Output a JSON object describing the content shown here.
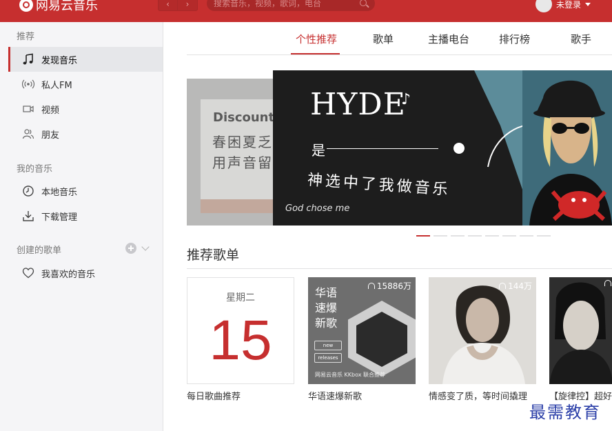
{
  "app": {
    "title": "网易云音乐",
    "search_placeholder": "搜索音乐，视频，歌词，电台",
    "user_label": "未登录",
    "accent_color": "#c62f2f"
  },
  "sidebar": {
    "section_recommend": "推荐",
    "items_recommend": [
      {
        "label": "发现音乐",
        "icon": "music-note-icon",
        "active": true
      },
      {
        "label": "私人FM",
        "icon": "radio-icon"
      },
      {
        "label": "视频",
        "icon": "video-icon"
      },
      {
        "label": "朋友",
        "icon": "friends-icon"
      }
    ],
    "section_my_music": "我的音乐",
    "items_my_music": [
      {
        "label": "本地音乐",
        "icon": "clock-icon"
      },
      {
        "label": "下载管理",
        "icon": "download-icon"
      }
    ],
    "section_created": "创建的歌单",
    "items_created": [
      {
        "label": "我喜欢的音乐",
        "icon": "heart-icon"
      }
    ]
  },
  "tabs": [
    {
      "label": "个性推荐",
      "active": true
    },
    {
      "label": "歌单"
    },
    {
      "label": "主播电台"
    },
    {
      "label": "排行榜"
    },
    {
      "label": "歌手"
    }
  ],
  "banner_left": {
    "line1": "Discount",
    "line2": "春困夏乏",
    "line3": "用声音留"
  },
  "banner_main": {
    "title": "HYDE",
    "note": "♪",
    "line_shi": "是",
    "line_main": "神选中了我做音乐",
    "line_en": "God chose me",
    "slide_count": 8,
    "active_slide": 1
  },
  "section": {
    "title": "推荐歌单"
  },
  "playlists": [
    {
      "caption": "每日歌曲推荐",
      "weekday": "星期二",
      "day": "15"
    },
    {
      "caption": "华语速爆新歌",
      "count": "15886万",
      "cover_text": "华语\n速爆\n新歌",
      "pill1": "new",
      "pill2": "releases",
      "footer": "网易云音乐 KKbox 联合推荐"
    },
    {
      "caption": "情感变了质，等时间撬理",
      "count": "144万"
    },
    {
      "caption": "【旋律控】超好"
    }
  ],
  "watermark": "最需教育"
}
